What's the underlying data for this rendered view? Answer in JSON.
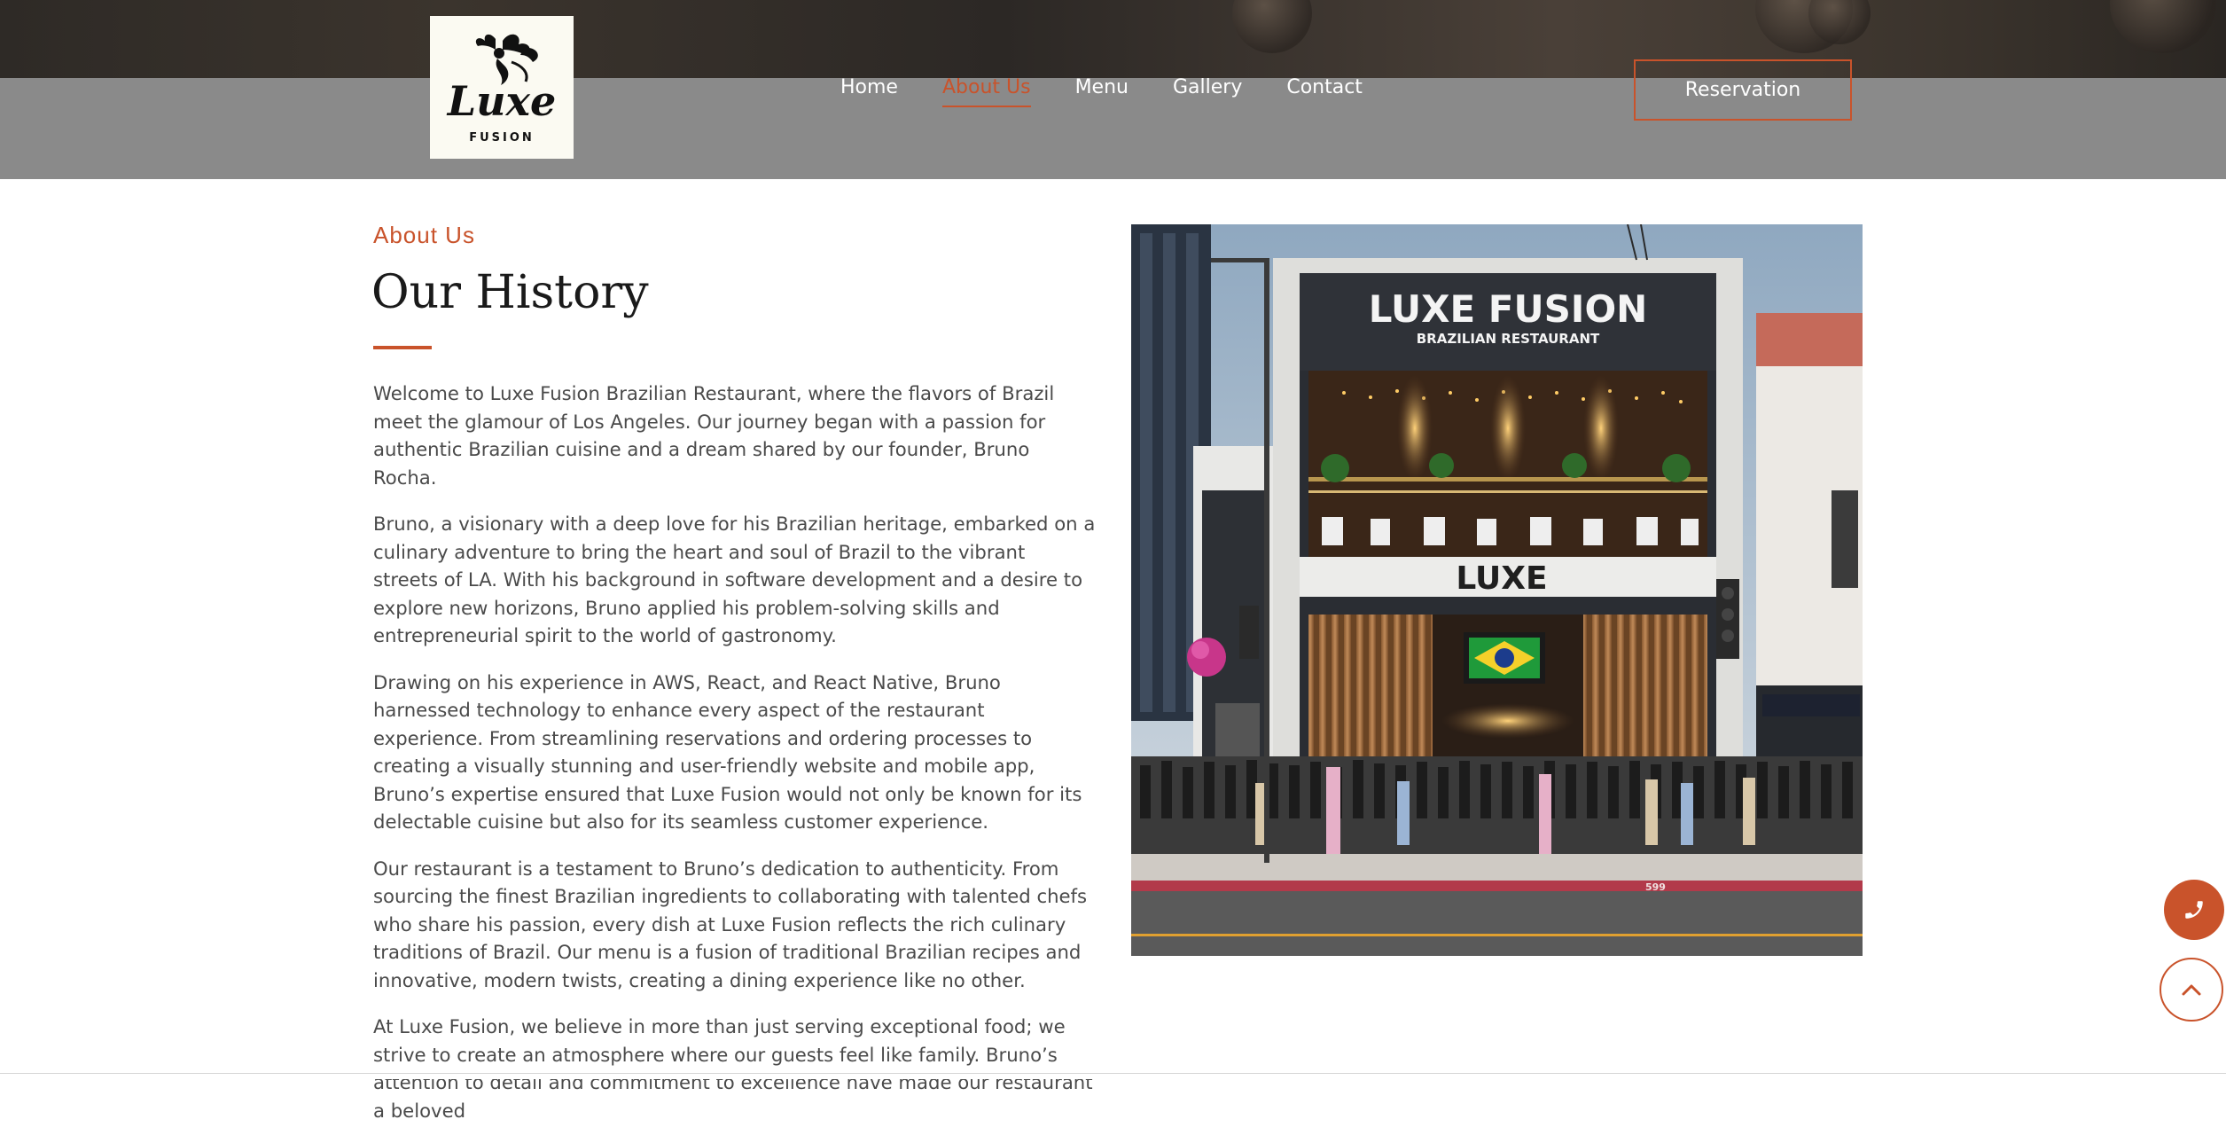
{
  "brand": {
    "logo_script": "Luxe",
    "logo_sub": "FUSION"
  },
  "nav": {
    "items": [
      {
        "label": "Home",
        "active": false
      },
      {
        "label": "About Us",
        "active": true
      },
      {
        "label": "Menu",
        "active": false
      },
      {
        "label": "Gallery",
        "active": false
      },
      {
        "label": "Contact",
        "active": false
      }
    ],
    "reservation_label": "Reservation"
  },
  "about": {
    "kicker": "About Us",
    "title": "Our History",
    "paragraphs": [
      "Welcome to Luxe Fusion Brazilian Restaurant, where the flavors of Brazil meet the glamour of Los Angeles. Our journey began with a passion for authentic Brazilian cuisine and a dream shared by our founder, Bruno Rocha.",
      "Bruno, a visionary with a deep love for his Brazilian heritage, embarked on a culinary adventure to bring the heart and soul of Brazil to the vibrant streets of LA. With his background in software development and a desire to explore new horizons, Bruno applied his problem-solving skills and entrepreneurial spirit to the world of gastronomy.",
      "Drawing on his experience in AWS, React, and React Native, Bruno harnessed technology to enhance every aspect of the restaurant experience. From streamlining reservations and ordering processes to creating a visually stunning and user-friendly website and mobile app, Bruno’s expertise ensured that Luxe Fusion would not only be known for its delectable cuisine but also for its seamless customer experience.",
      "Our restaurant is a testament to Bruno’s dedication to authenticity. From sourcing the finest Brazilian ingredients to collaborating with talented chefs who share his passion, every dish at Luxe Fusion reflects the rich culinary traditions of Brazil. Our menu is a fusion of traditional Brazilian recipes and innovative, modern twists, creating a dining experience like no other.",
      "At Luxe Fusion, we believe in more than just serving exceptional food; we strive to create an atmosphere where our guests feel like family. Bruno’s attention to detail and commitment to excellence have made our restaurant a beloved"
    ]
  },
  "photo": {
    "sign_title": "LUXE FUSION",
    "sign_subtitle": "BRAZILIAN RESTAURANT",
    "facade_label": "LUXE",
    "curb_number": "599"
  },
  "floating": {
    "phone_icon": "phone-icon",
    "top_icon": "chevron-up-icon"
  },
  "colors": {
    "accent": "#c9532b",
    "header_bg": "#8a8a8a",
    "text": "#4a4a4a",
    "heading": "#1a1a1a"
  }
}
